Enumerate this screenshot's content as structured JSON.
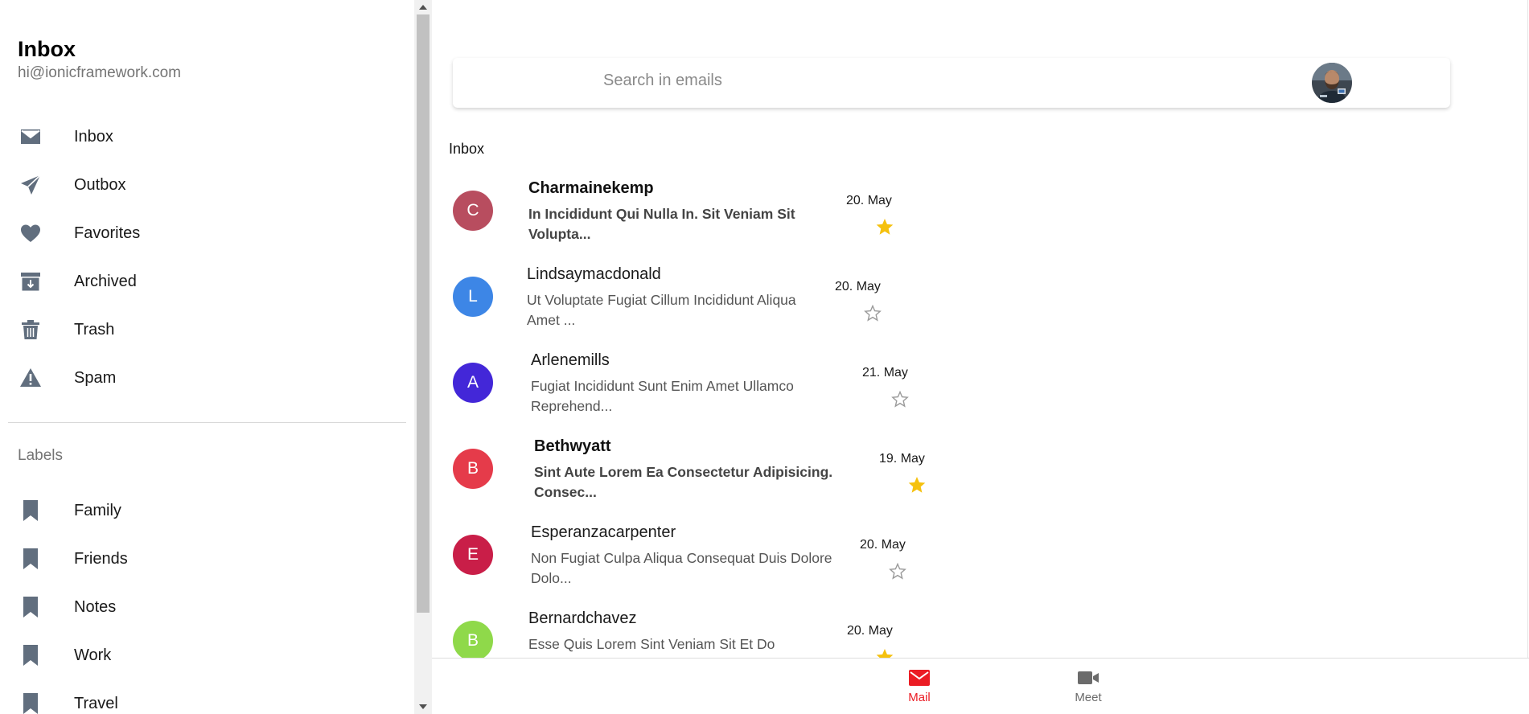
{
  "menu": {
    "title": "Inbox",
    "subtitle": "hi@ionicframework.com",
    "items": [
      {
        "label": "Inbox",
        "icon": "mail-icon"
      },
      {
        "label": "Outbox",
        "icon": "paper-plane-icon"
      },
      {
        "label": "Favorites",
        "icon": "heart-icon"
      },
      {
        "label": "Archived",
        "icon": "archive-icon"
      },
      {
        "label": "Trash",
        "icon": "trash-icon"
      },
      {
        "label": "Spam",
        "icon": "warning-icon"
      }
    ],
    "labels_header": "Labels",
    "labels": [
      {
        "label": "Family",
        "icon": "bookmark-icon"
      },
      {
        "label": "Friends",
        "icon": "bookmark-icon"
      },
      {
        "label": "Notes",
        "icon": "bookmark-icon"
      },
      {
        "label": "Work",
        "icon": "bookmark-icon"
      },
      {
        "label": "Travel",
        "icon": "bookmark-icon"
      }
    ],
    "icon_color": "#616e7e"
  },
  "search": {
    "placeholder": "Search in emails"
  },
  "list": {
    "header": "Inbox",
    "emails": [
      {
        "initial": "C",
        "color": "#b84d5f",
        "sender": "Charmainekemp",
        "subject": "In Incididunt Qui Nulla In. Sit Veniam Sit Volupta...",
        "date": "20. May",
        "starred": true,
        "unread": true
      },
      {
        "initial": "L",
        "color": "#3d86e6",
        "sender": "Lindsaymacdonald",
        "subject": "Ut Voluptate Fugiat Cillum Incididunt Aliqua Amet ...",
        "date": "20. May",
        "starred": false,
        "unread": false
      },
      {
        "initial": "A",
        "color": "#4327d8",
        "sender": "Arlenemills",
        "subject": "Fugiat Incididunt Sunt Enim Amet Ullamco Reprehend...",
        "date": "21. May",
        "starred": false,
        "unread": false
      },
      {
        "initial": "B",
        "color": "#e53b4a",
        "sender": "Bethwyatt",
        "subject": "Sint Aute Lorem Ea Consectetur Adipisicing. Consec...",
        "date": "19. May",
        "starred": true,
        "unread": true
      },
      {
        "initial": "E",
        "color": "#c91e48",
        "sender": "Esperanzacarpenter",
        "subject": "Non Fugiat Culpa Aliqua Consequat Duis Dolore Dolo...",
        "date": "20. May",
        "starred": false,
        "unread": false
      },
      {
        "initial": "B",
        "color": "#8fd94a",
        "sender": "Bernardchavez",
        "subject": "Esse Quis Lorem Sint Veniam Sit Et Do",
        "date": "20. May",
        "starred": true,
        "unread": false
      }
    ],
    "star_color": "#f5c10e",
    "star_outline_color": "#9a9a9a"
  },
  "tabs": [
    {
      "label": "Mail",
      "icon": "mail-icon",
      "active": true
    },
    {
      "label": "Meet",
      "icon": "video-camera-icon",
      "active": false
    }
  ],
  "colors": {
    "tab_active": "#eb1c24",
    "tab_inactive": "#6b6b6b"
  }
}
